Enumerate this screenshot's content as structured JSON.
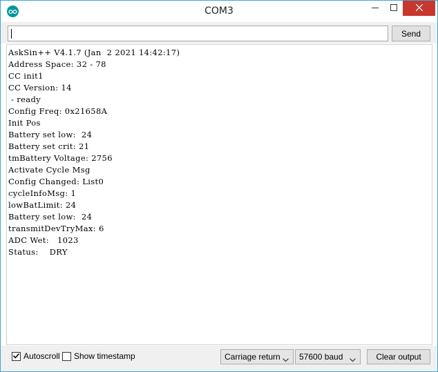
{
  "window": {
    "title": "COM3"
  },
  "input": {
    "value": "",
    "send_label": "Send"
  },
  "output": {
    "lines": [
      "AskSin++ V4.1.7 (Jan  2 2021 14:42:17)",
      "Address Space: 32 - 78",
      "CC init1",
      "CC Version: 14",
      " - ready",
      "Config Freq: 0x21658A",
      "Init Pos",
      "Battery set low:  24",
      "Battery set crit: 21",
      "tmBattery Voltage: 2756",
      "Activate Cycle Msg",
      "Config Changed: List0",
      "cycleInfoMsg: 1",
      "lowBatLimit: 24",
      "Battery set low:  24",
      "transmitDevTryMax: 6",
      "ADC Wet:   1023",
      "Status:    DRY"
    ]
  },
  "bottom": {
    "autoscroll": {
      "label": "Autoscroll",
      "checked": true
    },
    "timestamp": {
      "label": "Show timestamp",
      "checked": false
    },
    "line_ending": "Carriage return",
    "baud": "57600 baud",
    "clear_label": "Clear output"
  },
  "colors": {
    "close_button": "#c7372e",
    "app_icon": "#00979c",
    "window_border": "#3aa8d8"
  },
  "icons": [
    "arduino-icon",
    "minimize-icon",
    "maximize-icon",
    "close-icon",
    "check-icon",
    "chevron-down-icon"
  ]
}
